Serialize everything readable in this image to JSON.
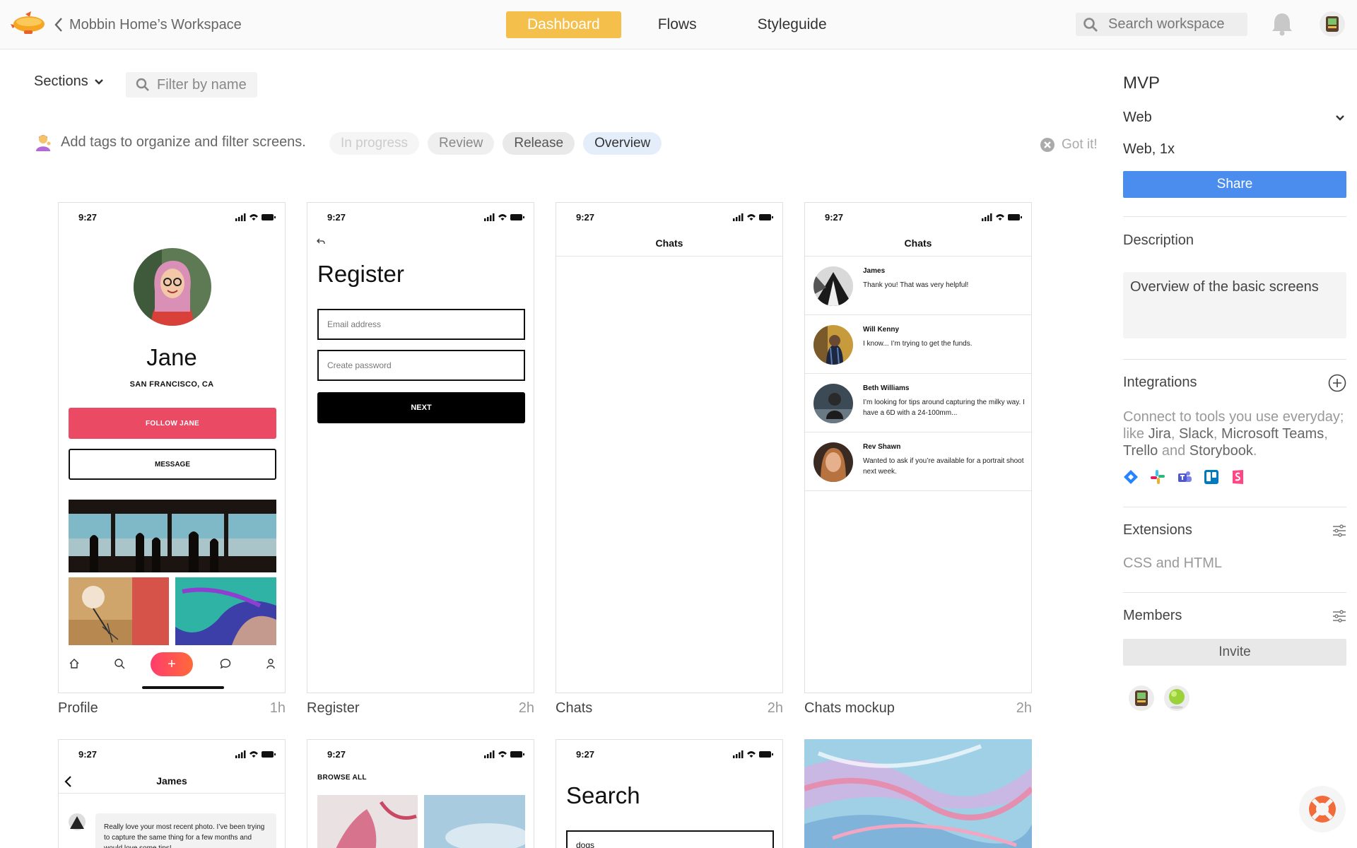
{
  "header": {
    "workspace": "Mobbin Home’s Workspace",
    "tabs": [
      {
        "label": "Dashboard",
        "active": true
      },
      {
        "label": "Flows",
        "active": false
      },
      {
        "label": "Styleguide",
        "active": false
      }
    ],
    "search_placeholder": "Search workspace"
  },
  "toolbar": {
    "sections_label": "Sections",
    "filter_placeholder": "Filter by name",
    "hint": "Add tags to organize and filter screens.",
    "tags": [
      "In progress",
      "Review",
      "Release",
      "Overview"
    ],
    "got_it": "Got it!"
  },
  "cards": [
    {
      "name": "Profile",
      "time": "1h"
    },
    {
      "name": "Register",
      "time": "2h"
    },
    {
      "name": "Chats",
      "time": "2h"
    },
    {
      "name": "Chats mockup",
      "time": "2h"
    }
  ],
  "phone": {
    "time": "9:27"
  },
  "profile": {
    "name": "Jane",
    "location": "SAN FRANCISCO, CA",
    "follow": "FOLLOW JANE",
    "message": "MESSAGE",
    "plus": "+"
  },
  "register": {
    "title": "Register",
    "email_placeholder": "Email address",
    "password_placeholder": "Create password",
    "next": "NEXT"
  },
  "chats": {
    "title": "Chats",
    "items": [
      {
        "name": "James",
        "text": "Thank you! That was very helpful!"
      },
      {
        "name": "Will Kenny",
        "text": "I know... I’m trying to get the funds."
      },
      {
        "name": "Beth Williams",
        "text": "I’m looking for tips around capturing the milky way. I have a 6D with a 24-100mm..."
      },
      {
        "name": "Rev Shawn",
        "text": "Wanted to ask if you’re available for a portrait shoot next week."
      }
    ]
  },
  "james": {
    "title": "James",
    "message": "Really love your most recent photo. I’ve been trying to capture the same thing for a few months and would love some tips!"
  },
  "browse": {
    "title": "BROWSE ALL"
  },
  "search_screen": {
    "title": "Search",
    "query": "dogs"
  },
  "panel": {
    "title": "MVP",
    "platform": "Web",
    "scale": "Web, 1x",
    "share": "Share",
    "description_label": "Description",
    "description": "Overview of the basic screens",
    "integrations_label": "Integrations",
    "integrations_text": {
      "t1": "Connect to tools you use everyday; like ",
      "jira": "Jira",
      "c1": ", ",
      "slack": "Slack",
      "c2": ", ",
      "teams": "Microsoft Teams",
      "c3": ", ",
      "trello": "Trello",
      "and": " and ",
      "storybook": "Storybook",
      "end": "."
    },
    "extensions_label": "Extensions",
    "extensions_text": "CSS and HTML",
    "members_label": "Members",
    "invite": "Invite"
  },
  "colors": {
    "accent_yellow": "#f4c04b",
    "share_blue": "#4a8def",
    "follow_red": "#eb4a64"
  }
}
